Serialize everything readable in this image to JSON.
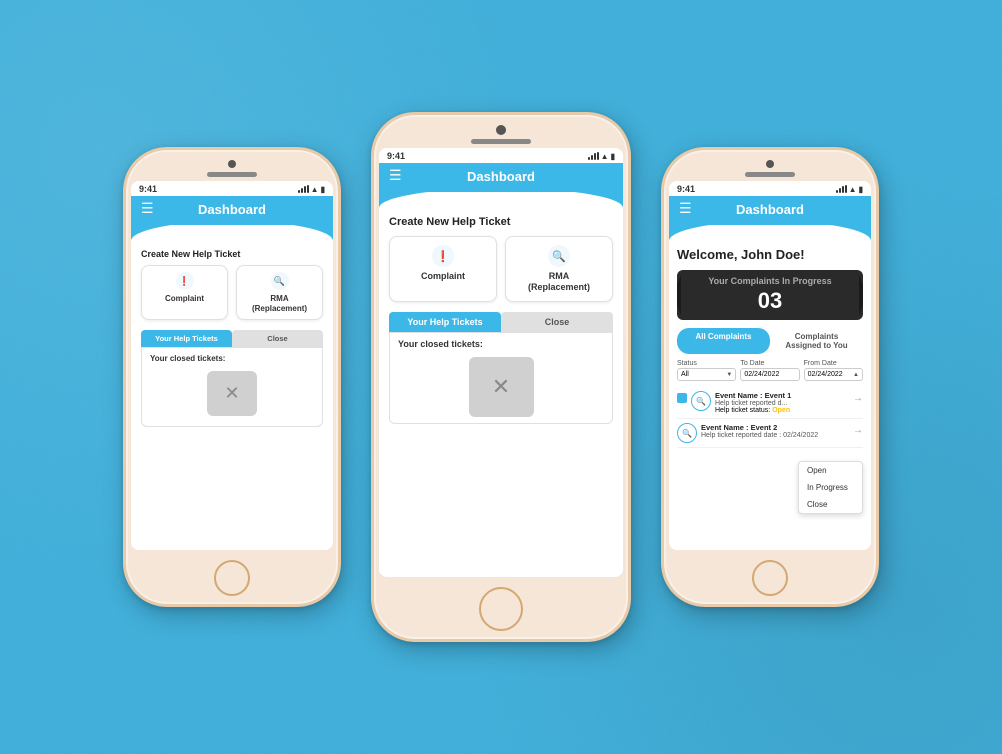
{
  "background": {
    "color": "#3BB8E8"
  },
  "phones": {
    "left": {
      "size": "small",
      "statusBar": {
        "time": "9:41"
      },
      "header": {
        "title": "Dashboard"
      },
      "content": {
        "sectionTitle": "Create New Help Ticket",
        "buttons": [
          {
            "label": "Complaint",
            "icon": "!"
          },
          {
            "label": "RMA\n(Replacement)",
            "icon": "🔍"
          }
        ],
        "tabs": [
          {
            "label": "Your Help Tickets",
            "active": true
          },
          {
            "label": "Close",
            "active": false
          }
        ],
        "closedLabel": "Your closed tickets:",
        "emptyIcon": "✕"
      }
    },
    "center": {
      "size": "large",
      "statusBar": {
        "time": "9:41"
      },
      "header": {
        "title": "Dashboard"
      },
      "content": {
        "sectionTitle": "Create New Help Ticket",
        "buttons": [
          {
            "label": "Complaint",
            "icon": "!"
          },
          {
            "label": "RMA\n(Replacement)",
            "icon": "🔍"
          }
        ],
        "tabs": [
          {
            "label": "Your Help Tickets",
            "active": true
          },
          {
            "label": "Close",
            "active": false
          }
        ],
        "closedLabel": "Your closed tickets:",
        "emptyIcon": "✕"
      }
    },
    "right": {
      "size": "small",
      "statusBar": {
        "time": "9:41"
      },
      "header": {
        "title": "Dashboard"
      },
      "content": {
        "welcomeTitle": "Welcome, John Doe!",
        "banner": {
          "title": "Your Complaints In Progress",
          "count": "03"
        },
        "allComplaintsTab": "All Complaints",
        "assignedTab": "Complaints Assigned to You",
        "filters": {
          "statusLabel": "Status",
          "statusValue": "All",
          "toDateLabel": "To Date",
          "toDateValue": "02/24/2022",
          "fromDateLabel": "From Date",
          "fromDateValue": "02/24/2022"
        },
        "dropdown": {
          "items": [
            "Open",
            "In Progress",
            "Close"
          ]
        },
        "tickets": [
          {
            "name": "Event Name : Event 1",
            "date": "Help ticket reported d...",
            "status": "Help ticket status: Open",
            "statusColor": "open"
          },
          {
            "name": "Event Name : Event 2",
            "date": "Help ticket reported date : 02/24/2022",
            "status": "",
            "statusColor": ""
          }
        ]
      }
    }
  }
}
